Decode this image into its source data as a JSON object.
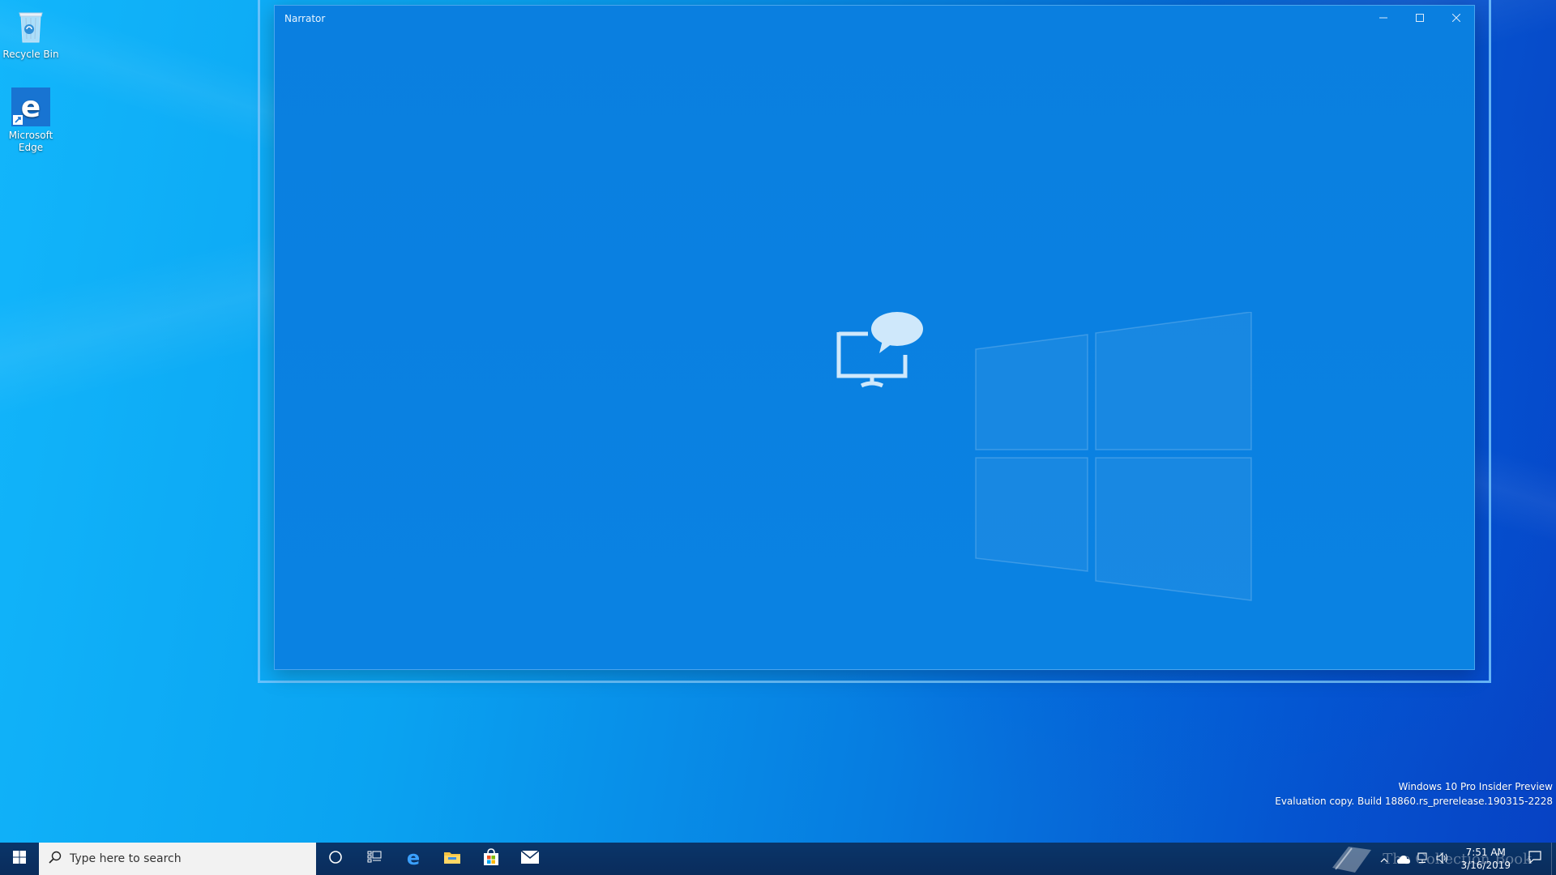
{
  "desktop": {
    "icons": [
      {
        "label": "Recycle Bin",
        "icon": "recycle-bin-icon"
      },
      {
        "label": "Microsoft Edge",
        "icon": "edge-icon"
      }
    ]
  },
  "window": {
    "title": "Narrator",
    "controls": {
      "minimize": "minimize-icon",
      "maximize": "maximize-icon",
      "close": "close-icon"
    },
    "content_icon": "narrator-icon"
  },
  "watermark": {
    "line1": "Windows 10 Pro Insider Preview",
    "line2": "Evaluation copy. Build 18860.rs_prerelease.190315-2228"
  },
  "taskbar": {
    "search_placeholder": "Type here to search",
    "pinned": [
      "cortana-icon",
      "task-view-icon",
      "edge-icon",
      "file-explorer-icon",
      "store-icon",
      "mail-icon"
    ],
    "clock": {
      "time": "7:51 AM",
      "date": "3/16/2019"
    },
    "brand_text": "The Collection Book"
  },
  "colors": {
    "accent": "#0a82e2",
    "taskbar": "#0a2c5c",
    "search_bg": "#f2f2f2"
  }
}
